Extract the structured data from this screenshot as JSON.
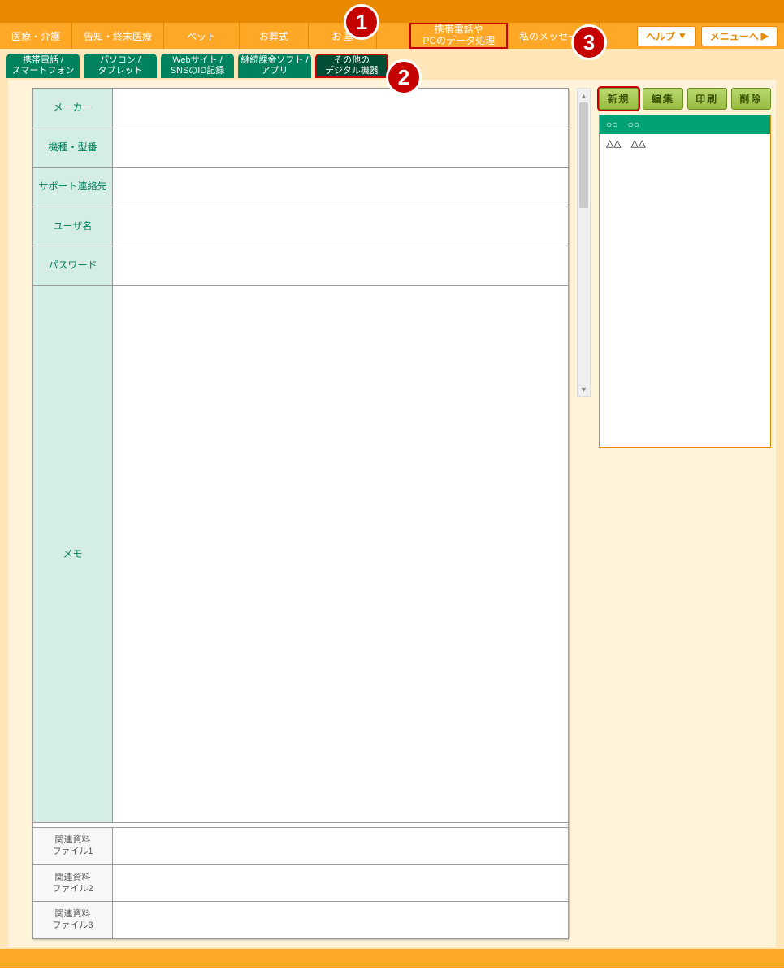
{
  "topNav": {
    "items": [
      {
        "label": "医療・介護"
      },
      {
        "label": "告知・終末医療"
      },
      {
        "label": "ペット"
      },
      {
        "label": "お葬式"
      },
      {
        "label": "お 墓"
      },
      {
        "label_line1": "携帯電話や",
        "label_line2": "PCのデータ処理",
        "highlighted": true
      },
      {
        "label": "私のメッセージ"
      }
    ],
    "helpBtn": "ヘルプ",
    "menuBtn": "メニューへ"
  },
  "subTabs": [
    {
      "line1": "携帯電話 /",
      "line2": "スマートフォン"
    },
    {
      "line1": "パソコン /",
      "line2": "タブレット"
    },
    {
      "line1": "Webサイト /",
      "line2": "SNSのID記録"
    },
    {
      "line1": "継続課金ソフト /",
      "line2": "アプリ"
    },
    {
      "line1": "その他の",
      "line2": "デジタル機器",
      "active": true
    }
  ],
  "form": {
    "fields": [
      {
        "label": "メーカー",
        "value": ""
      },
      {
        "label": "機種・型番",
        "value": ""
      },
      {
        "label": "サポート連絡先",
        "value": ""
      },
      {
        "label": "ユーザ名",
        "value": ""
      },
      {
        "label": "パスワード",
        "value": ""
      }
    ],
    "memo": {
      "label": "メモ",
      "value": ""
    },
    "files": [
      {
        "line1": "関連資料",
        "line2": "ファイル1"
      },
      {
        "line1": "関連資料",
        "line2": "ファイル2"
      },
      {
        "line1": "関連資料",
        "line2": "ファイル3"
      }
    ]
  },
  "actions": {
    "new": "新規",
    "edit": "編集",
    "print": "印刷",
    "delete": "削除"
  },
  "list": {
    "items": [
      {
        "text": "○○　○○",
        "selected": true
      },
      {
        "text": "△△　△△",
        "selected": false
      }
    ]
  },
  "callouts": {
    "c1": "1",
    "c2": "2",
    "c3": "3"
  }
}
